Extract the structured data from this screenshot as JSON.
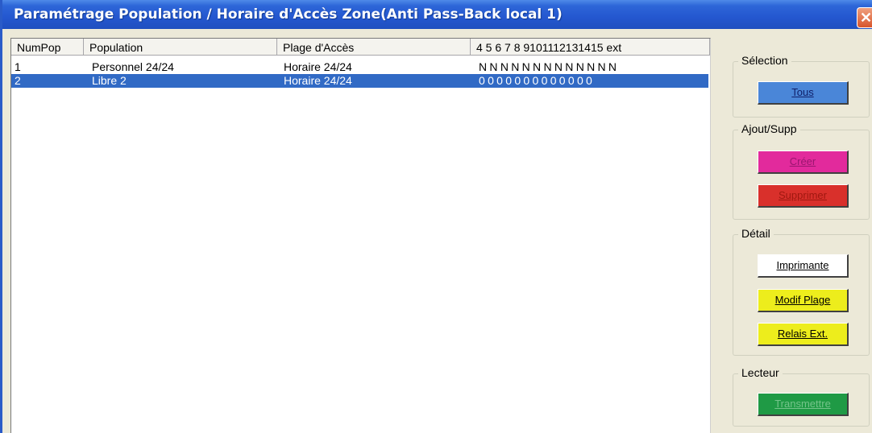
{
  "window": {
    "title": "Paramétrage Population / Horaire d'Accès Zone(Anti Pass-Back local 1)",
    "close_glyph": "✕"
  },
  "table": {
    "columns": [
      "NumPop",
      "Population",
      "Plage d'Accès",
      "4  5  6 7  8 9101112131415  ext"
    ],
    "rows": [
      {
        "num": "1",
        "population": "Personnel 24/24",
        "plage": "Horaire 24/24",
        "codes": "NNNNNNNNNNNNN",
        "selected": false
      },
      {
        "num": "2",
        "population": "Libre 2",
        "plage": "Horaire 24/24",
        "codes": "0000000000000",
        "selected": true
      }
    ]
  },
  "groups": {
    "selection": {
      "label": "Sélection",
      "tous": "Tous"
    },
    "ajout_supp": {
      "label": "Ajout/Supp",
      "creer": "Créer",
      "supprimer": "Supprimer"
    },
    "detail": {
      "label": "Détail",
      "imprimante": "Imprimante",
      "modif_plage": "Modif Plage",
      "relais_ext": "Relais Ext."
    },
    "lecteur": {
      "label": "Lecteur",
      "transmettre": "Transmettre"
    }
  },
  "colors": {
    "tous": "#4a86d8",
    "creer": "#e22a9c",
    "supprimer": "#d9302b",
    "imprimante": "#ffffff",
    "modif_plage": "#eded1c",
    "relais_ext": "#eded1c",
    "transmettre": "#1f9a45",
    "selection_row": "#316ac5"
  }
}
